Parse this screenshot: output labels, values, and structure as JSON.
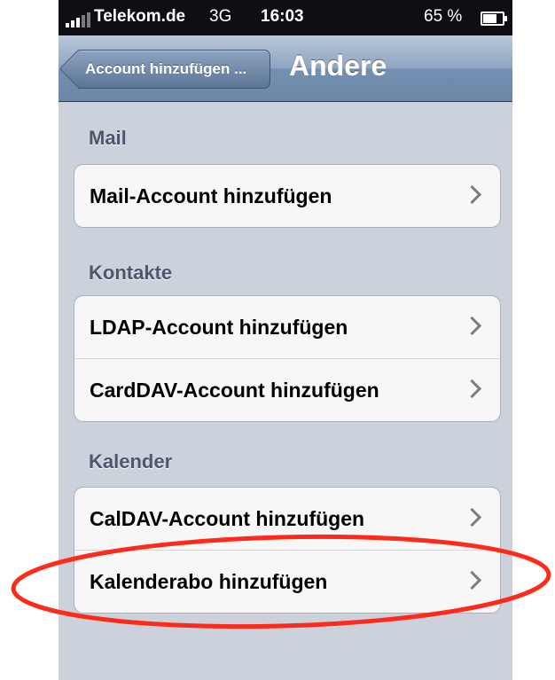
{
  "status_bar": {
    "carrier": "Telekom.de",
    "network": "3G",
    "time": "16:03",
    "battery": "65 %",
    "battery_level": 0.65
  },
  "nav": {
    "back_label": "Account hinzufügen ...",
    "title": "Andere"
  },
  "sections": [
    {
      "header": "Mail",
      "rows": [
        {
          "label": "Mail-Account hinzufügen"
        }
      ]
    },
    {
      "header": "Kontakte",
      "rows": [
        {
          "label": "LDAP-Account hinzufügen"
        },
        {
          "label": "CardDAV-Account hinzufügen"
        }
      ]
    },
    {
      "header": "Kalender",
      "rows": [
        {
          "label": "CalDAV-Account hinzufügen"
        },
        {
          "label": "Kalenderabo hinzufügen"
        }
      ]
    }
  ],
  "colors": {
    "annotation": "#ff2a1a",
    "background": "#cbd2db"
  },
  "icons": [
    "signal-icon",
    "battery-icon",
    "chevron-right-icon",
    "back-arrow-icon"
  ]
}
